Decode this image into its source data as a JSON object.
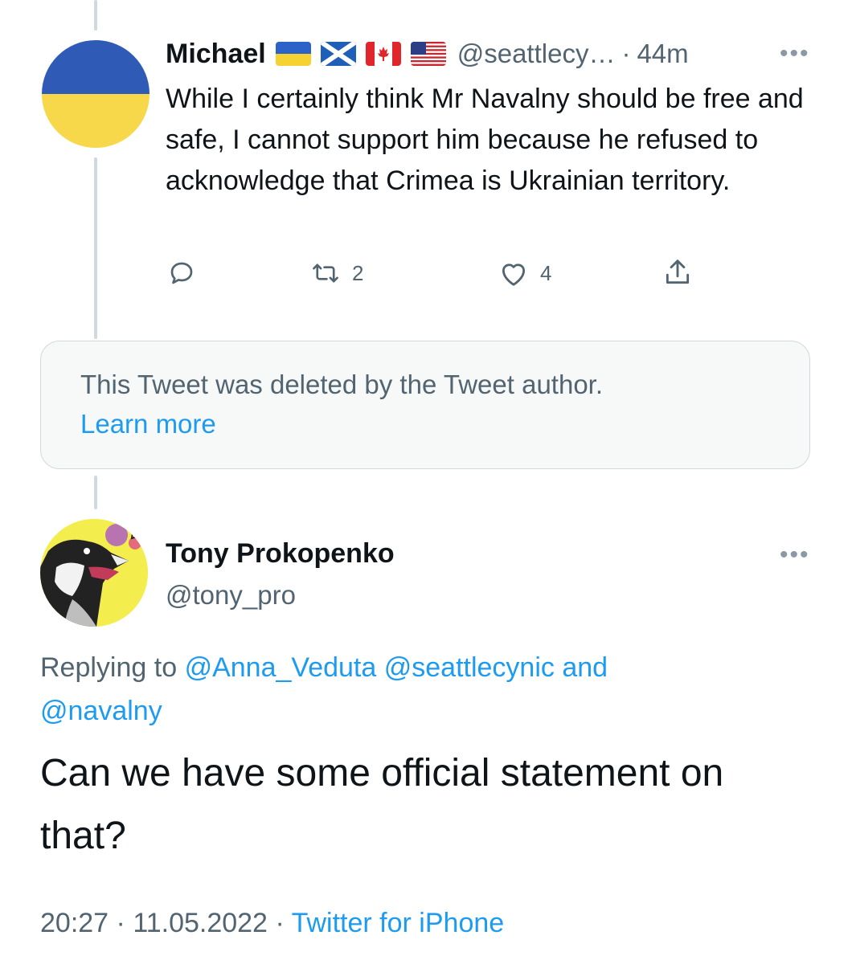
{
  "tweet_main": {
    "author_name": "Michael",
    "flags": [
      "flag-ukraine-icon",
      "flag-scotland-icon",
      "flag-canada-icon",
      "flag-usa-icon"
    ],
    "handle": "@seattlecy…",
    "separator": "·",
    "time": "44m",
    "more_label": "•••",
    "text": "While I certainly think Mr Navalny should be free and safe, I cannot support him because he refused to acknowledge that Crimea is Ukrainian territory.",
    "actions": {
      "reply_icon": "reply-icon",
      "retweet_count": "2",
      "like_count": "4",
      "share_icon": "share-icon"
    }
  },
  "deleted_notice": {
    "text": "This Tweet was deleted by the Tweet author.",
    "learn_more": "Learn more"
  },
  "tweet_reply": {
    "author_name": "Tony Prokopenko",
    "handle": "@tony_pro",
    "more_label": "•••",
    "replying_prefix": "Replying to",
    "replying_users": [
      "@Anna_Veduta",
      "@seattlecynic"
    ],
    "replying_and": "and",
    "replying_last": "@navalny",
    "text": "Can we have some official statement on that?",
    "time": "20:27",
    "date": "11.05.2022",
    "separator": "·",
    "source": "Twitter for iPhone"
  },
  "colors": {
    "link": "#1d9bf0",
    "secondary_text": "#536471",
    "thread_line": "#cfd9de",
    "deleted_bg": "#f7f9f9"
  }
}
